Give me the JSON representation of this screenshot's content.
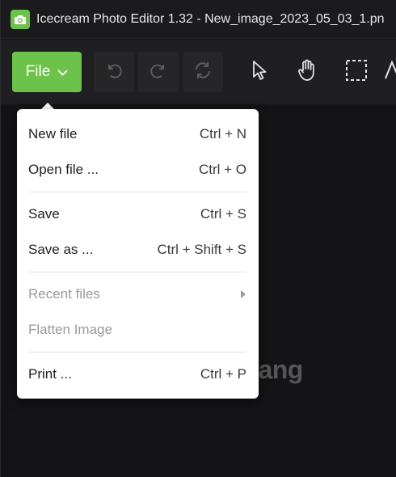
{
  "window": {
    "title": "Icecream Photo Editor 1.32 - New_image_2023_05_03_1.pn"
  },
  "toolbar": {
    "file_label": "File",
    "tools": [
      "undo-icon",
      "redo-icon",
      "reset-icon",
      "pointer-icon",
      "hand-icon",
      "selection-icon",
      "text-icon"
    ]
  },
  "file_menu": {
    "items": [
      {
        "label": "New file",
        "shortcut": "Ctrl + N",
        "enabled": true
      },
      {
        "label": "Open file ...",
        "shortcut": "Ctrl + O",
        "enabled": true
      },
      {
        "label": "Save",
        "shortcut": "Ctrl + S",
        "enabled": true
      },
      {
        "label": "Save as ...",
        "shortcut": "Ctrl + Shift + S",
        "enabled": true
      },
      {
        "label": "Recent files",
        "shortcut": "",
        "enabled": false,
        "submenu": true
      },
      {
        "label": "Flatten Image",
        "shortcut": "",
        "enabled": false
      },
      {
        "label": "Print ...",
        "shortcut": "Ctrl + P",
        "enabled": true
      }
    ]
  },
  "watermark": {
    "text": "trimang"
  },
  "colors": {
    "accent": "#6cc24a",
    "background": "#161618",
    "menu_background": "#ffffff",
    "disabled_text": "#9a9a9a"
  }
}
